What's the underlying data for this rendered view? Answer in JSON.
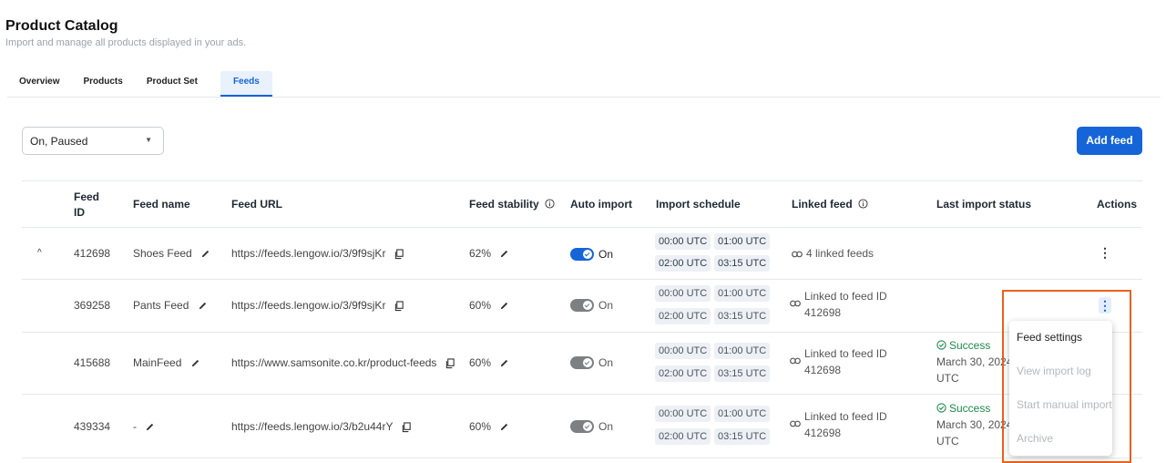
{
  "page": {
    "title": "Product Catalog",
    "subtitle": "Import and manage all products displayed in your ads."
  },
  "tabs": [
    {
      "label": "Overview"
    },
    {
      "label": "Products"
    },
    {
      "label": "Product Set"
    },
    {
      "label": "Feeds",
      "active": true
    }
  ],
  "filter": {
    "value": "On, Paused"
  },
  "add_feed_label": "Add feed",
  "table": {
    "headers": {
      "feed_id_line1": "Feed",
      "feed_id_line2": "ID",
      "feed_name": "Feed name",
      "feed_url": "Feed URL",
      "feed_stability": "Feed stability",
      "auto_import": "Auto import",
      "import_schedule": "Import schedule",
      "linked_feed": "Linked feed",
      "last_import_status": "Last import status",
      "actions": "Actions"
    },
    "rows": [
      {
        "expand_icon": "chevron-up-icon",
        "id": "412698",
        "name": "Shoes Feed",
        "url": "https://feeds.lengow.io/3/9f9sjKr",
        "stability": "62%",
        "auto_import_label": "On",
        "auto_import_enabled": true,
        "schedule": [
          "00:00 UTC",
          "01:00 UTC",
          "02:00 UTC",
          "03:15 UTC"
        ],
        "linked_line1": "4 linked feeds",
        "linked_line2": "",
        "status_line1": "",
        "status_line2": "",
        "status_line3": ""
      },
      {
        "id": "369258",
        "name": "Pants Feed",
        "url": "https://feeds.lengow.io/3/9f9sjKr",
        "stability": "60%",
        "auto_import_label": "On",
        "auto_import_enabled": false,
        "schedule": [
          "00:00 UTC",
          "01:00 UTC",
          "02:00 UTC",
          "03:15 UTC"
        ],
        "linked_line1": "Linked to feed ID",
        "linked_line2": "412698",
        "status_line1": "",
        "status_line2": "",
        "status_line3": ""
      },
      {
        "id": "415688",
        "name": "MainFeed",
        "url": "https://www.samsonite.co.kr/product-feeds",
        "stability": "60%",
        "auto_import_label": "On",
        "auto_import_enabled": false,
        "schedule": [
          "00:00 UTC",
          "01:00 UTC",
          "02:00 UTC",
          "03:15 UTC"
        ],
        "linked_line1": "Linked to feed ID",
        "linked_line2": "412698",
        "status_line1": "Success",
        "status_line2": "March 30, 2024",
        "status_line3": "UTC"
      },
      {
        "id": "439334",
        "name": "-",
        "url": "https://feeds.lengow.io/3/b2u44rY",
        "stability": "60%",
        "auto_import_label": "On",
        "auto_import_enabled": false,
        "schedule": [
          "00:00 UTC",
          "01:00 UTC",
          "02:00 UTC",
          "03:15 UTC"
        ],
        "linked_line1": "Linked to feed ID",
        "linked_line2": "412698",
        "status_line1": "Success",
        "status_line2": "March 30, 2024",
        "status_line3": "UTC"
      }
    ]
  },
  "actions_menu": {
    "items": [
      {
        "label": "Feed settings",
        "enabled": true
      },
      {
        "label": "View import log",
        "enabled": false
      },
      {
        "label": "Start manual import",
        "enabled": false
      },
      {
        "label": "Archive",
        "enabled": false
      }
    ]
  },
  "colors": {
    "accent": "#1565d8",
    "highlight": "#e8621c",
    "success": "#1e8a49"
  }
}
